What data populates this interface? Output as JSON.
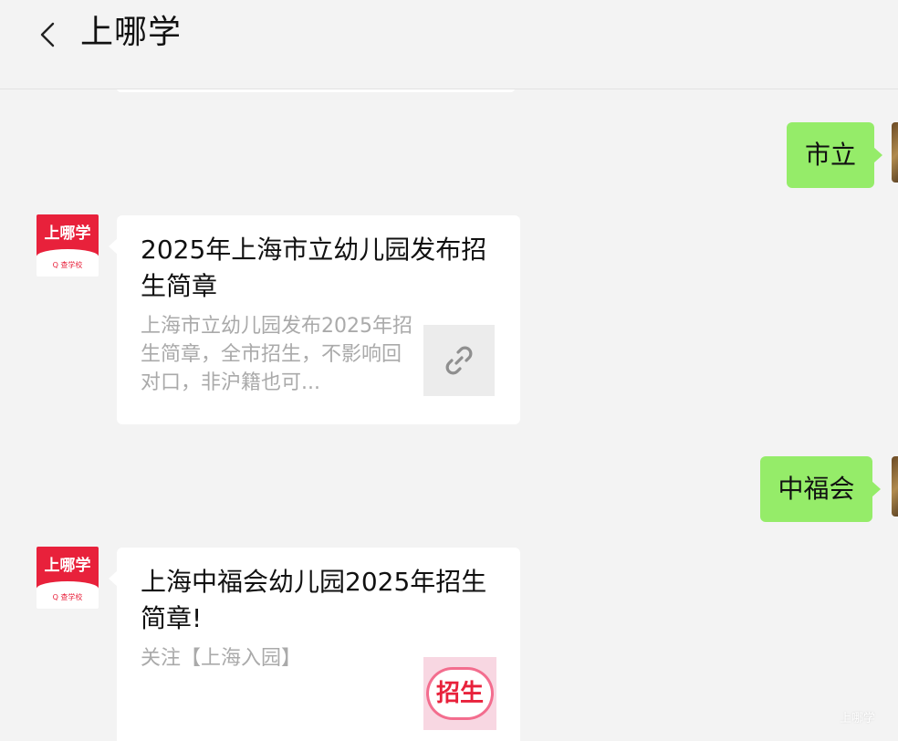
{
  "header": {
    "title": "上哪学",
    "back_icon": "chevron-left-icon"
  },
  "messages": [
    {
      "side": "right",
      "text": "市立"
    },
    {
      "side": "left",
      "avatar": {
        "logo_text": "上哪学",
        "sub_text": "Q 查学校"
      },
      "title": "2025年上海市立幼儿园发布招生简章",
      "desc": "上海市立幼儿园发布2025年招生简章，全市招生，不影响回对口，非沪籍也可...",
      "thumb_icon": "link-icon"
    },
    {
      "side": "right",
      "text": "中福会"
    },
    {
      "side": "left",
      "avatar": {
        "logo_text": "上哪学",
        "sub_text": "Q 查学校"
      },
      "title": "上海中福会幼儿园2025年招生简章!",
      "desc": "关注【上海入园】",
      "thumb_text": "招生"
    }
  ],
  "watermark": "上哪学",
  "colors": {
    "background": "#f3f3f3",
    "outgoing_bubble": "#95ec69",
    "card": "#ffffff",
    "brand_red": "#e8213b"
  }
}
